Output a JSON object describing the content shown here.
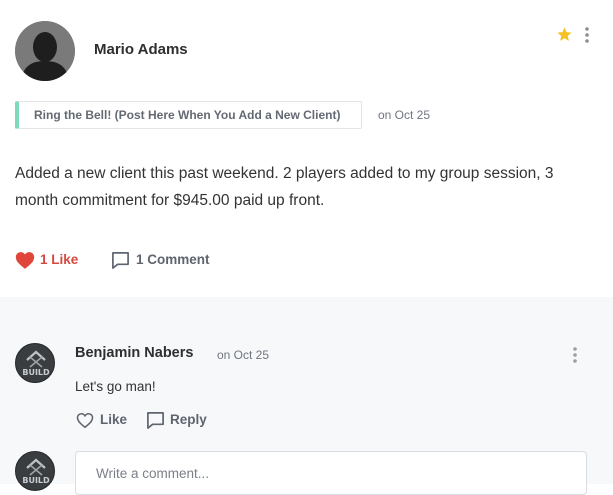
{
  "post": {
    "author_name": "Mario Adams",
    "topic": "Ring the Bell! (Post Here When You Add a New Client)",
    "date": "on Oct 25",
    "body": "Added a new client this past weekend. 2 players added to my group session, 3 month commitment for $945.00 paid up front.",
    "likes_label": "1 Like",
    "comments_label": "1 Comment",
    "icons": {
      "star": "star-icon",
      "menu": "more-vertical-icon",
      "like": "heart-icon",
      "comment": "comment-icon"
    },
    "colors": {
      "star": "#f5c125",
      "like": "#d54941",
      "topic_accent": "#7ed9b9"
    }
  },
  "comment": {
    "author_name": "Benjamin Nabers",
    "date": "on Oct 25",
    "text": "Let's go man!",
    "like_label": "Like",
    "reply_label": "Reply",
    "avatar_text": "BUILD"
  },
  "composer": {
    "placeholder": "Write a comment...",
    "avatar_text": "BUILD"
  }
}
